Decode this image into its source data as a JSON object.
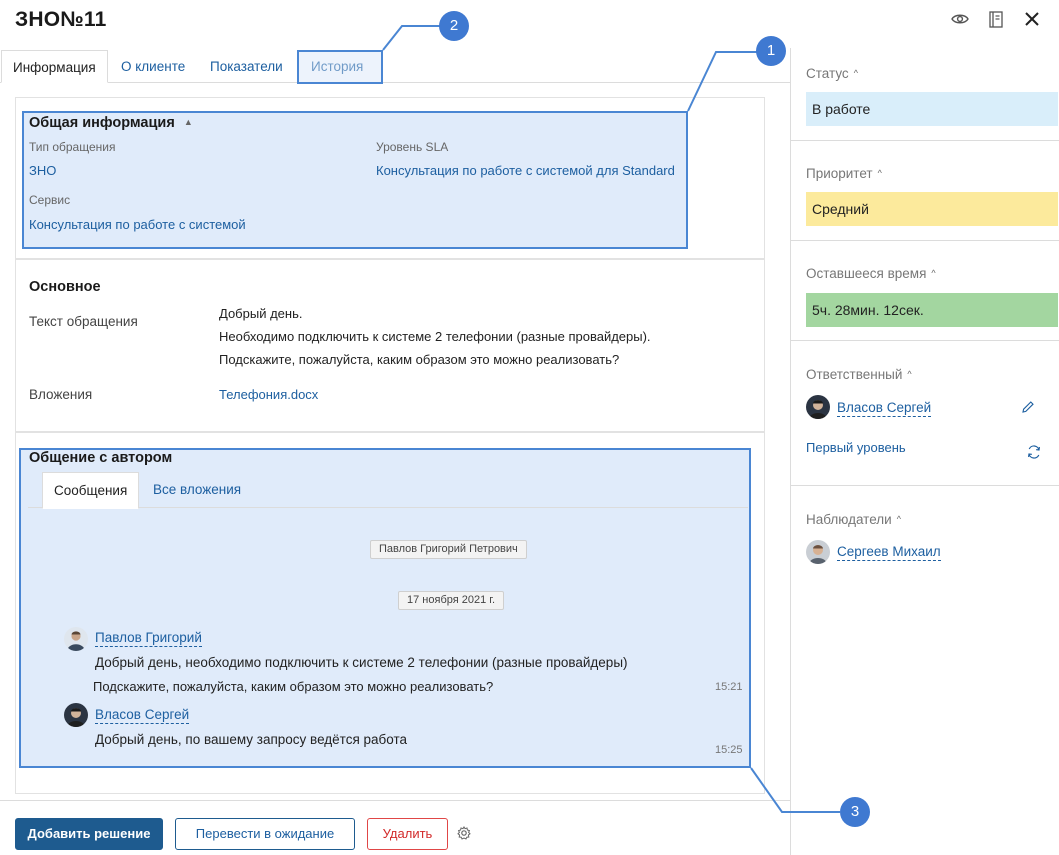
{
  "header": {
    "title": "ЗНО№11"
  },
  "tabs": [
    {
      "label": "Информация"
    },
    {
      "label": "О клиенте"
    },
    {
      "label": "Показатели"
    },
    {
      "label": "История"
    }
  ],
  "general_info": {
    "title": "Общая информация",
    "request_type_label": "Тип обращения",
    "request_type_value": "ЗНО",
    "sla_label": "Уровень SLA",
    "sla_value": "Консультация по работе с системой для Standard",
    "service_label": "Сервис",
    "service_value": "Консультация по работе с системой"
  },
  "basic": {
    "title": "Основное",
    "text_label": "Текст обращения",
    "text_lines": [
      "Добрый день.",
      "Необходимо подключить к системе 2 телефонии (разные провайдеры).",
      "Подскажите, пожалуйста, каким образом это можно реализовать?"
    ],
    "attachments_label": "Вложения",
    "attachment": "Телефония.docx"
  },
  "communication": {
    "title": "Общение с автором",
    "subtabs": [
      {
        "label": "Сообщения"
      },
      {
        "label": "Все вложения"
      }
    ],
    "author_chip": "Павлов Григорий Петрович",
    "date_chip": "17 ноября 2021 г.",
    "messages": [
      {
        "author": "Павлов Григорий",
        "line1": "Добрый день, необходимо подключить к системе 2 телефонии (разные провайдеры)",
        "line2": "Подскажите, пожалуйста, каким образом это можно реализовать?",
        "time": "15:21"
      },
      {
        "author": "Власов Сергей",
        "line1": "Добрый день, по вашему запросу ведётся работа",
        "time": "15:25"
      }
    ]
  },
  "actions": {
    "add_solution": "Добавить решение",
    "to_waiting": "Перевести в ожидание",
    "delete": "Удалить"
  },
  "sidebar": {
    "status": {
      "title": "Статус",
      "value": "В работе",
      "color": "#d9eefa"
    },
    "priority": {
      "title": "Приоритет",
      "value": "Средний",
      "color": "#fcea9c"
    },
    "remaining": {
      "title": "Оставшееся время",
      "value": "5ч. 28мин. 12сек.",
      "color": "#a3d6a0"
    },
    "responsible": {
      "title": "Ответственный",
      "person": "Власов Сергей",
      "group": "Первый уровень"
    },
    "observers": {
      "title": "Наблюдатели",
      "person": "Сергеев Михаил"
    }
  },
  "callouts": [
    "1",
    "2",
    "3"
  ],
  "colors": {
    "accent": "#1e5b8f",
    "link": "#1d5fa0",
    "highlight_border": "#4a86d3",
    "marker": "#3f79d1",
    "danger": "#e04646"
  }
}
